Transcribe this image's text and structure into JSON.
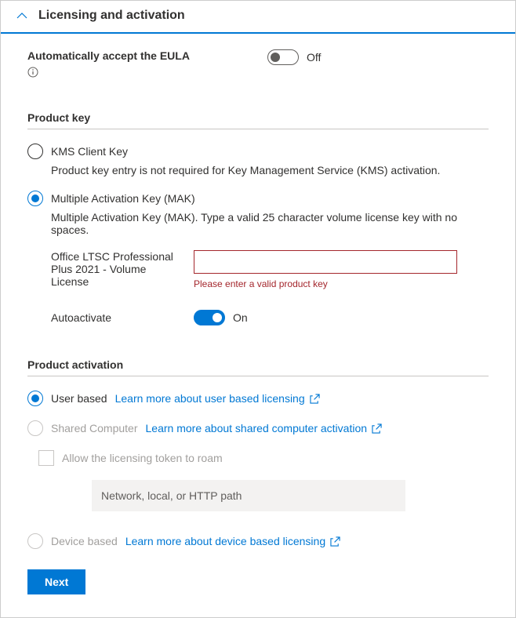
{
  "header": {
    "title": "Licensing and activation"
  },
  "eula": {
    "label": "Automatically accept the EULA",
    "toggle_state": "Off"
  },
  "product_key": {
    "section_title": "Product key",
    "options": {
      "kms": {
        "label": "KMS Client Key",
        "desc": "Product key entry is not required for Key Management Service (KMS) activation."
      },
      "mak": {
        "label": "Multiple Activation Key (MAK)",
        "desc": "Multiple Activation Key (MAK). Type a valid 25 character volume license key with no spaces.",
        "field_label": "Office LTSC Professional Plus 2021 - Volume License",
        "field_value": "",
        "error": "Please enter a valid product key"
      }
    },
    "autoactivate": {
      "label": "Autoactivate",
      "toggle_state": "On"
    }
  },
  "product_activation": {
    "section_title": "Product activation",
    "user_based": {
      "label": "User based",
      "link": "Learn more about user based licensing"
    },
    "shared_computer": {
      "label": "Shared Computer",
      "link": "Learn more about shared computer activation",
      "roam_label": "Allow the licensing token to roam",
      "path_placeholder": "Network, local, or HTTP path"
    },
    "device_based": {
      "label": "Device based",
      "link": "Learn more about device based licensing"
    }
  },
  "footer": {
    "next": "Next"
  }
}
